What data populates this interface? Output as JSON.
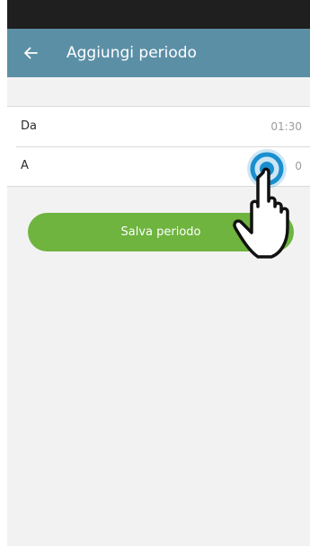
{
  "header": {
    "title": "Aggiungi periodo",
    "back_icon": "arrow-left-icon"
  },
  "form": {
    "rows": [
      {
        "label": "Da",
        "value": "01:30"
      },
      {
        "label": "A",
        "value": "0"
      }
    ]
  },
  "actions": {
    "save_label": "Salva periodo"
  },
  "overlay": {
    "icon": "tap-hand-icon"
  },
  "colors": {
    "statusbar": "#1f1f1f",
    "appbar": "#5b8fa6",
    "background": "#f2f2f2",
    "primary_button": "#6eb43f",
    "tap_ring": "#1a8fcf"
  }
}
